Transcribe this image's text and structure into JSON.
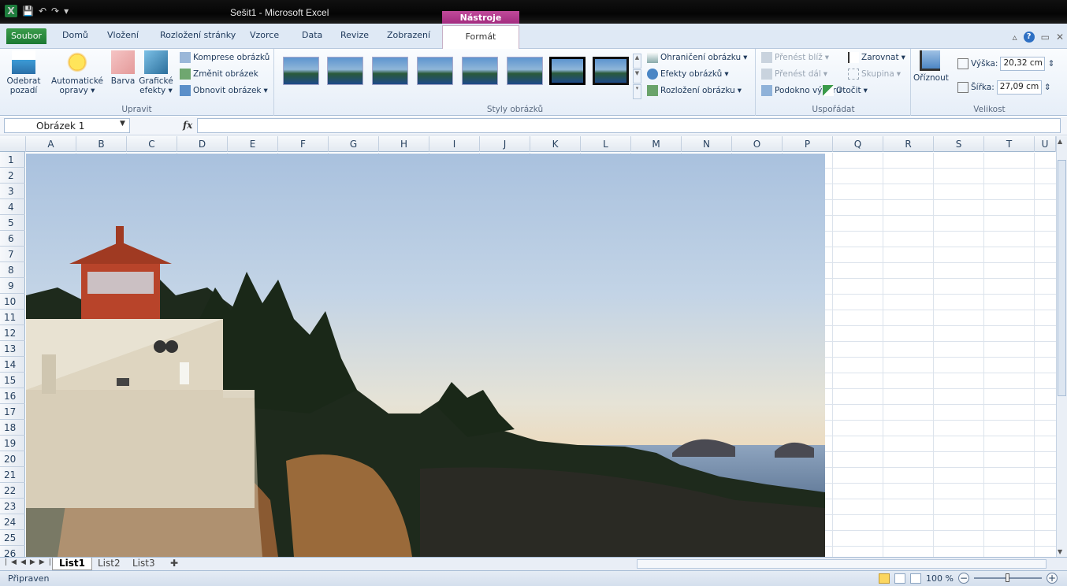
{
  "window": {
    "title": "Sešit1 - Microsoft Excel",
    "context_tab_group": "Nástroje obrázku"
  },
  "tabs": [
    "Soubor",
    "Domů",
    "Vložení",
    "Rozložení stránky",
    "Vzorce",
    "Data",
    "Revize",
    "Zobrazení",
    "Formát"
  ],
  "ribbon": {
    "upravit": {
      "label": "Upravit",
      "remove_bg": "Odebrat pozadí",
      "auto_fix": "Automatické opravy",
      "color": "Barva",
      "artistic": "Grafické efekty",
      "compress": "Komprese obrázků",
      "change": "Změnit obrázek",
      "reset": "Obnovit obrázek"
    },
    "styles": {
      "label": "Styly obrázků",
      "border": "Ohraničení obrázku",
      "effects": "Efekty obrázků",
      "layout": "Rozložení obrázku"
    },
    "arrange": {
      "label": "Uspořádat",
      "forward": "Přenést blíž",
      "backward": "Přenést dál",
      "pane": "Podokno výběru",
      "align": "Zarovnat",
      "group": "Skupina",
      "rotate": "Otočit"
    },
    "size": {
      "label": "Velikost",
      "crop": "Oříznout",
      "height_label": "Výška:",
      "height": "20,32 cm",
      "width_label": "Šířka:",
      "width": "27,09 cm"
    }
  },
  "formula_bar": {
    "name_box": "Obrázek 1",
    "fx": "fx",
    "value": ""
  },
  "columns": [
    "A",
    "B",
    "C",
    "D",
    "E",
    "F",
    "G",
    "H",
    "I",
    "J",
    "K",
    "L",
    "M",
    "N",
    "O",
    "P",
    "Q",
    "R",
    "S",
    "T",
    "U"
  ],
  "rows": [
    "1",
    "2",
    "3",
    "4",
    "5",
    "6",
    "7",
    "8",
    "9",
    "10",
    "11",
    "12",
    "13",
    "14",
    "15",
    "16",
    "17",
    "18",
    "19",
    "20",
    "21",
    "22",
    "23",
    "24",
    "25",
    "26"
  ],
  "sheets": [
    "List1",
    "List2",
    "List3"
  ],
  "status": {
    "text": "Připraven",
    "zoom": "100 %"
  }
}
